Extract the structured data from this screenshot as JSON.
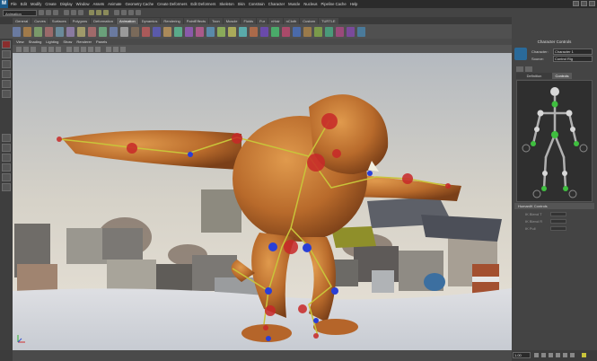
{
  "app": {
    "logo": "M"
  },
  "menus": [
    "File",
    "Edit",
    "Modify",
    "Create",
    "Display",
    "Window",
    "Assets",
    "Animate",
    "Geometry Cache",
    "Create Deformers",
    "Edit Deformers",
    "Skeleton",
    "Skin",
    "Constrain",
    "Character",
    "Muscle",
    "Nucleus",
    "Pipeline Cache",
    "Help"
  ],
  "status_line": {
    "mode": "Animation"
  },
  "shelf_tabs": [
    "General",
    "Curves",
    "Surfaces",
    "Polygons",
    "Deformation",
    "Animation",
    "Dynamics",
    "Rendering",
    "PaintEffects",
    "Toon",
    "Muscle",
    "Fluids",
    "Fur",
    "nHair",
    "nCloth",
    "Custom",
    "TURTLE"
  ],
  "shelf_tabs_active": "Animation",
  "viewport_menu": [
    "View",
    "Shading",
    "Lighting",
    "Show",
    "Renderer",
    "Panels"
  ],
  "timeline": {
    "range_value": "1.00"
  },
  "panel": {
    "title": "Character Controls",
    "character_label": "Character:",
    "character_value": "Character 1",
    "source_label": "Source:",
    "source_value": "Control Rig",
    "tabs": [
      "Definition",
      "Controls"
    ],
    "active_tab": "Controls",
    "custom_section": "HumanIK Controls",
    "custom_rows": [
      "IK Blend T",
      "IK Blend R",
      "IK Pull"
    ]
  },
  "icons": {
    "logo": "maya-logo-icon",
    "axis": "axis-indicator-icon"
  },
  "colors": {
    "accent_red": "#c82828",
    "accent_blue": "#2a3fd6",
    "bone_yellow": "#c9c43a",
    "rig_green": "#3fbf3f"
  }
}
